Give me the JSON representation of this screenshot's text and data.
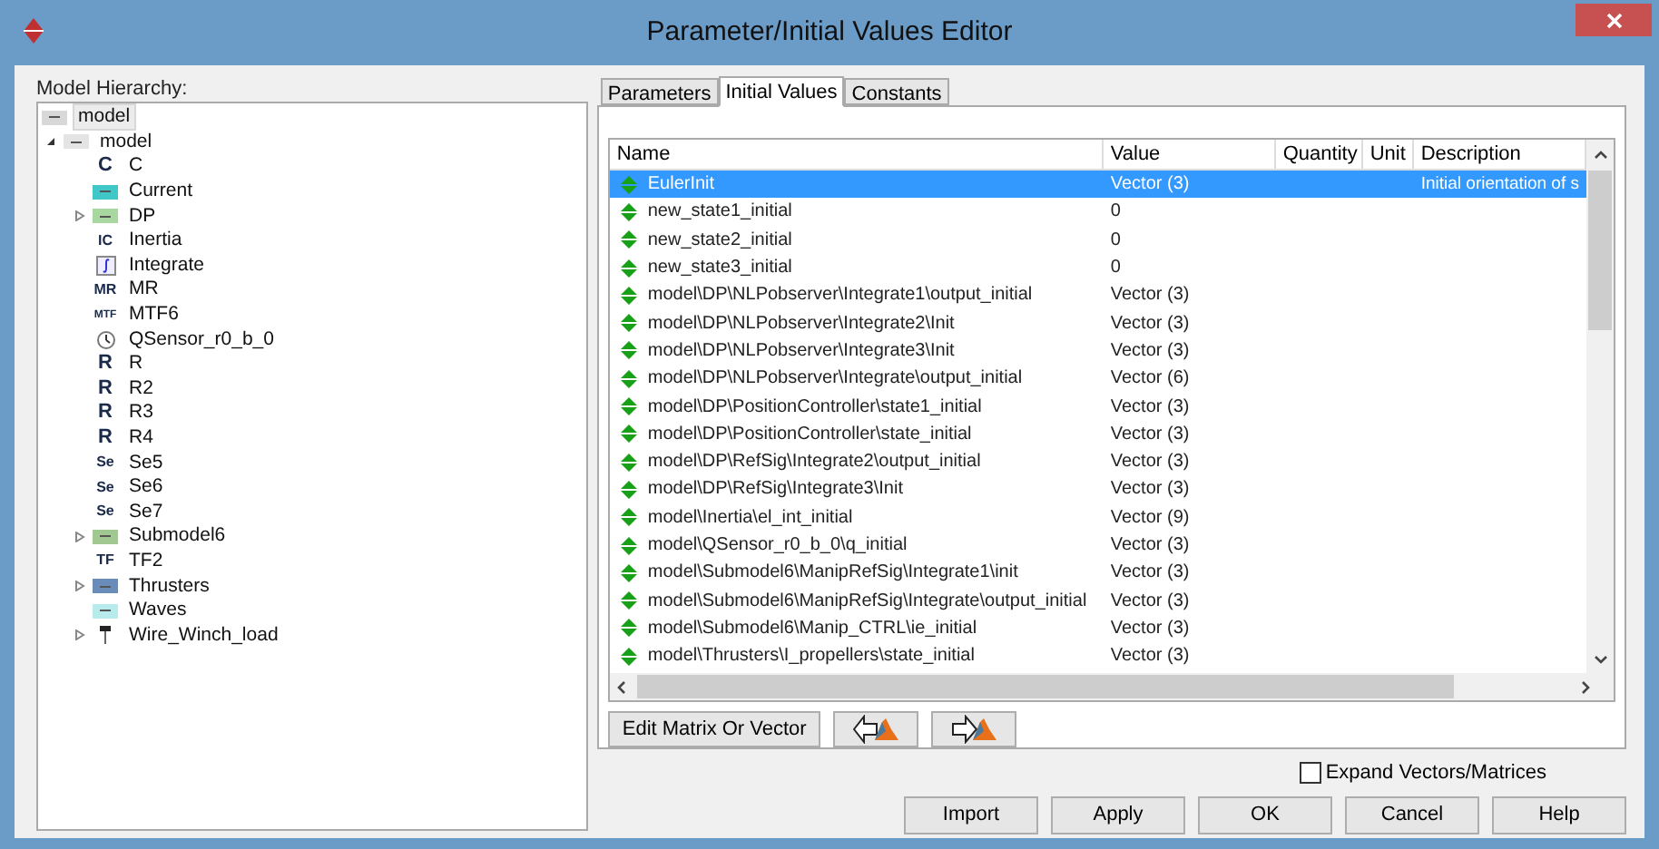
{
  "window": {
    "title": "Parameter/Initial Values Editor"
  },
  "hierarchy": {
    "label": "Model Hierarchy:",
    "items": [
      {
        "label": "model",
        "kind": "block",
        "color": "#d8d8d8",
        "selected": true
      },
      {
        "label": "model",
        "kind": "block",
        "color": "#e4e4e4",
        "selected": false,
        "expanded": true,
        "children": [
          {
            "label": "C",
            "kind": "glyph",
            "glyph": "C",
            "selected": false
          },
          {
            "label": "Current",
            "kind": "block",
            "color": "#40c8c8",
            "selected": false
          },
          {
            "label": "DP",
            "kind": "block",
            "color": "#a8d8a0",
            "selected": false,
            "expanded": false
          },
          {
            "label": "Inertia",
            "kind": "glyph",
            "glyph": "IC",
            "selected": false
          },
          {
            "label": "Integrate",
            "kind": "integrate",
            "selected": false
          },
          {
            "label": "MR",
            "kind": "glyph",
            "glyph": "MR",
            "selected": false
          },
          {
            "label": "MTF6",
            "kind": "glyph",
            "glyph": "MTF",
            "selected": false
          },
          {
            "label": "QSensor_r0_b_0",
            "kind": "sensor",
            "selected": false
          },
          {
            "label": "R",
            "kind": "glyph",
            "glyph": "R",
            "selected": false
          },
          {
            "label": "R2",
            "kind": "glyph",
            "glyph": "R",
            "selected": false
          },
          {
            "label": "R3",
            "kind": "glyph",
            "glyph": "R",
            "selected": false
          },
          {
            "label": "R4",
            "kind": "glyph",
            "glyph": "R",
            "selected": false
          },
          {
            "label": "Se5",
            "kind": "glyph",
            "glyph": "Se",
            "selected": false
          },
          {
            "label": "Se6",
            "kind": "glyph",
            "glyph": "Se",
            "selected": false
          },
          {
            "label": "Se7",
            "kind": "glyph",
            "glyph": "Se",
            "selected": false
          },
          {
            "label": "Submodel6",
            "kind": "block",
            "color": "#a0c890",
            "selected": false,
            "expanded": false
          },
          {
            "label": "TF2",
            "kind": "glyph",
            "glyph": "TF",
            "selected": false
          },
          {
            "label": "Thrusters",
            "kind": "block",
            "color": "#6a8cb8",
            "selected": false,
            "expanded": false
          },
          {
            "label": "Waves",
            "kind": "block",
            "color": "#b8ecec",
            "selected": false
          },
          {
            "label": "Wire_Winch_load",
            "kind": "winch",
            "selected": false,
            "expanded": false
          }
        ]
      }
    ]
  },
  "tabs": [
    {
      "label": "Parameters",
      "selected": false
    },
    {
      "label": "Initial Values",
      "selected": true
    },
    {
      "label": "Constants",
      "selected": false
    }
  ],
  "table": {
    "columns": [
      "Name",
      "Value",
      "Quantity",
      "Unit",
      "Description"
    ],
    "rows": [
      {
        "name": "EulerInit",
        "value": "Vector (3)",
        "description": "Initial orientation of s",
        "selected": true
      },
      {
        "name": "new_state1_initial",
        "value": "0",
        "selected": false
      },
      {
        "name": "new_state2_initial",
        "value": "0",
        "selected": false
      },
      {
        "name": "new_state3_initial",
        "value": "0",
        "selected": false
      },
      {
        "name": "model\\DP\\NLPobserver\\Integrate1\\output_initial",
        "value": "Vector (3)",
        "selected": false
      },
      {
        "name": "model\\DP\\NLPobserver\\Integrate2\\Init",
        "value": "Vector (3)",
        "selected": false
      },
      {
        "name": "model\\DP\\NLPobserver\\Integrate3\\Init",
        "value": "Vector (3)",
        "selected": false
      },
      {
        "name": "model\\DP\\NLPobserver\\Integrate\\output_initial",
        "value": "Vector (6)",
        "selected": false
      },
      {
        "name": "model\\DP\\PositionController\\state1_initial",
        "value": "Vector (3)",
        "selected": false
      },
      {
        "name": "model\\DP\\PositionController\\state_initial",
        "value": "Vector (3)",
        "selected": false
      },
      {
        "name": "model\\DP\\RefSig\\Integrate2\\output_initial",
        "value": "Vector (3)",
        "selected": false
      },
      {
        "name": "model\\DP\\RefSig\\Integrate3\\Init",
        "value": "Vector (3)",
        "selected": false
      },
      {
        "name": "model\\Inertia\\el_int_initial",
        "value": "Vector (9)",
        "selected": false
      },
      {
        "name": "model\\QSensor_r0_b_0\\q_initial",
        "value": "Vector (3)",
        "selected": false
      },
      {
        "name": "model\\Submodel6\\ManipRefSig\\Integrate1\\init",
        "value": "Vector (3)",
        "selected": false
      },
      {
        "name": "model\\Submodel6\\ManipRefSig\\Integrate\\output_initial",
        "value": "Vector (3)",
        "selected": false
      },
      {
        "name": "model\\Submodel6\\Manip_CTRL\\ie_initial",
        "value": "Vector (3)",
        "selected": false
      },
      {
        "name": "model\\Thrusters\\I_propellers\\state_initial",
        "value": "Vector (3)",
        "selected": false
      }
    ]
  },
  "edit_button": "Edit Matrix Or Vector",
  "expand_vectors": {
    "label": "Expand Vectors/Matrices",
    "checked": false
  },
  "buttons": [
    "Import",
    "Apply",
    "OK",
    "Cancel",
    "Help"
  ]
}
